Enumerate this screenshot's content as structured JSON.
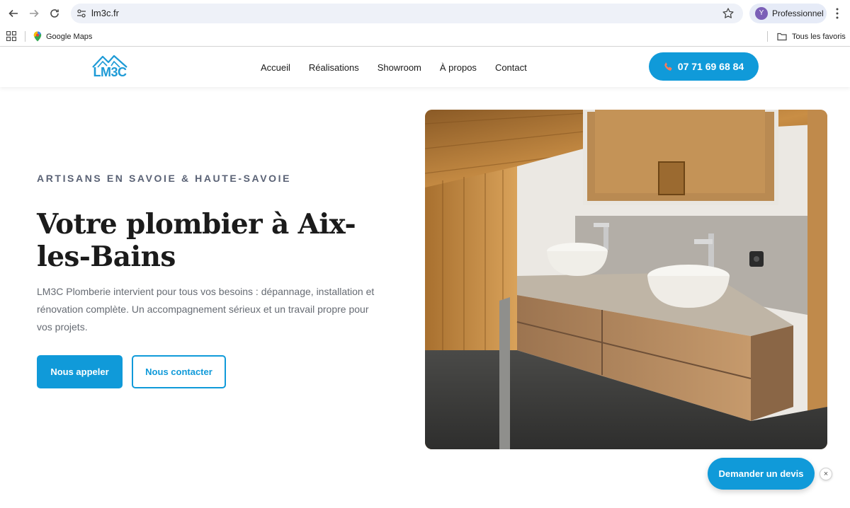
{
  "browser": {
    "url": "lm3c.fr",
    "profile_initial": "Y",
    "profile_name": "Professionnel",
    "bookmarks": [
      {
        "label": "Google Maps"
      }
    ],
    "all_bookmarks_label": "Tous les favoris"
  },
  "site": {
    "logo_text": "LM3C",
    "nav": [
      "Accueil",
      "Réalisations",
      "Showroom",
      "À propos",
      "Contact"
    ],
    "phone": "07 71 69 68 84",
    "accent_color": "#109ad9"
  },
  "hero": {
    "eyebrow": "ARTISANS EN SAVOIE & HAUTE-SAVOIE",
    "title": "Votre plombier à Aix-les-Bains",
    "text": "LM3C Plomberie intervient pour tous vos besoins : dépannage, installation et rénovation complète. Un accompagnement sérieux et un travail propre pour vos projets.",
    "btn_call": "Nous appeler",
    "btn_contact": "Nous contacter"
  },
  "floating": {
    "quote_label": "Demander un devis",
    "close_label": "×"
  }
}
